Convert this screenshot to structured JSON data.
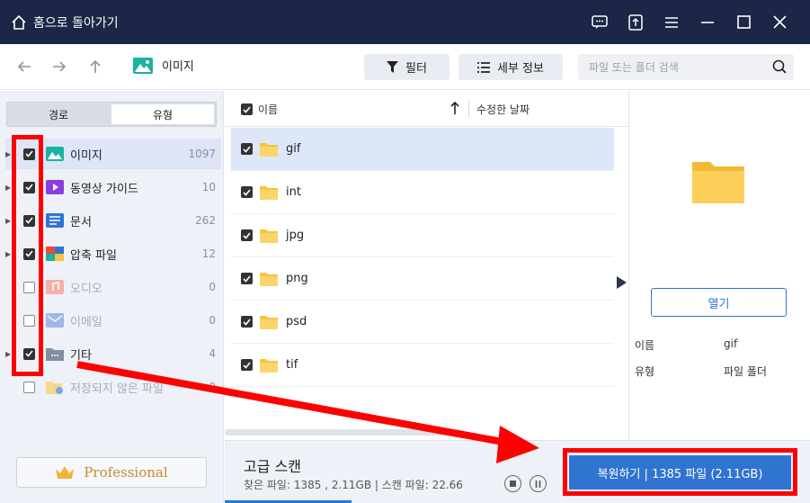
{
  "titlebar": {
    "home_label": "홈으로 돌아가기"
  },
  "breadcrumb": {
    "label": "이미지"
  },
  "toolbar": {
    "filter_label": "필터",
    "details_label": "세부 정보",
    "search_placeholder": "파일 또는 폴더 검색"
  },
  "sidebar": {
    "tabs": [
      {
        "label": "경로",
        "active": false
      },
      {
        "label": "유형",
        "active": true
      }
    ],
    "categories": [
      {
        "label": "이미지",
        "count": "1097",
        "checked": true,
        "icon": "image-icon",
        "selected": true
      },
      {
        "label": "동영상 가이드",
        "count": "10",
        "checked": true,
        "icon": "video-icon"
      },
      {
        "label": "문서",
        "count": "262",
        "checked": true,
        "icon": "document-icon"
      },
      {
        "label": "압축 파일",
        "count": "12",
        "checked": true,
        "icon": "archive-icon"
      },
      {
        "label": "오디오",
        "count": "0",
        "checked": false,
        "icon": "audio-icon",
        "dim": true
      },
      {
        "label": "이메일",
        "count": "0",
        "checked": false,
        "icon": "email-icon",
        "dim": true
      },
      {
        "label": "기타",
        "count": "4",
        "checked": true,
        "icon": "other-folder-icon"
      },
      {
        "label": "저장되지 않은 파일",
        "count": "0",
        "checked": false,
        "icon": "unsaved-file-icon",
        "dim": true
      }
    ],
    "pro_label": "Professional"
  },
  "filelist": {
    "col_name": "이름",
    "col_date": "수정한 날짜",
    "rows": [
      {
        "name": "gif",
        "checked": true,
        "selected": true
      },
      {
        "name": "int",
        "checked": true
      },
      {
        "name": "jpg",
        "checked": true
      },
      {
        "name": "png",
        "checked": true
      },
      {
        "name": "psd",
        "checked": true
      },
      {
        "name": "tif",
        "checked": true
      }
    ]
  },
  "detail": {
    "open_label": "열기",
    "name_key": "이름",
    "name_value": "gif",
    "type_key": "유형",
    "type_value": "파일 폴더"
  },
  "bottom": {
    "title": "고급 스캔",
    "status": "찾은 파일: 1385 , 2.11GB | 스캔 파일: 22.66",
    "recover_label": "복원하기 | 1385 파일 (2.11GB)"
  },
  "colors": {
    "titlebar": "#1c2646",
    "accent": "#2f74d0",
    "highlight": "#ff0000",
    "folder": "#f6c342"
  }
}
